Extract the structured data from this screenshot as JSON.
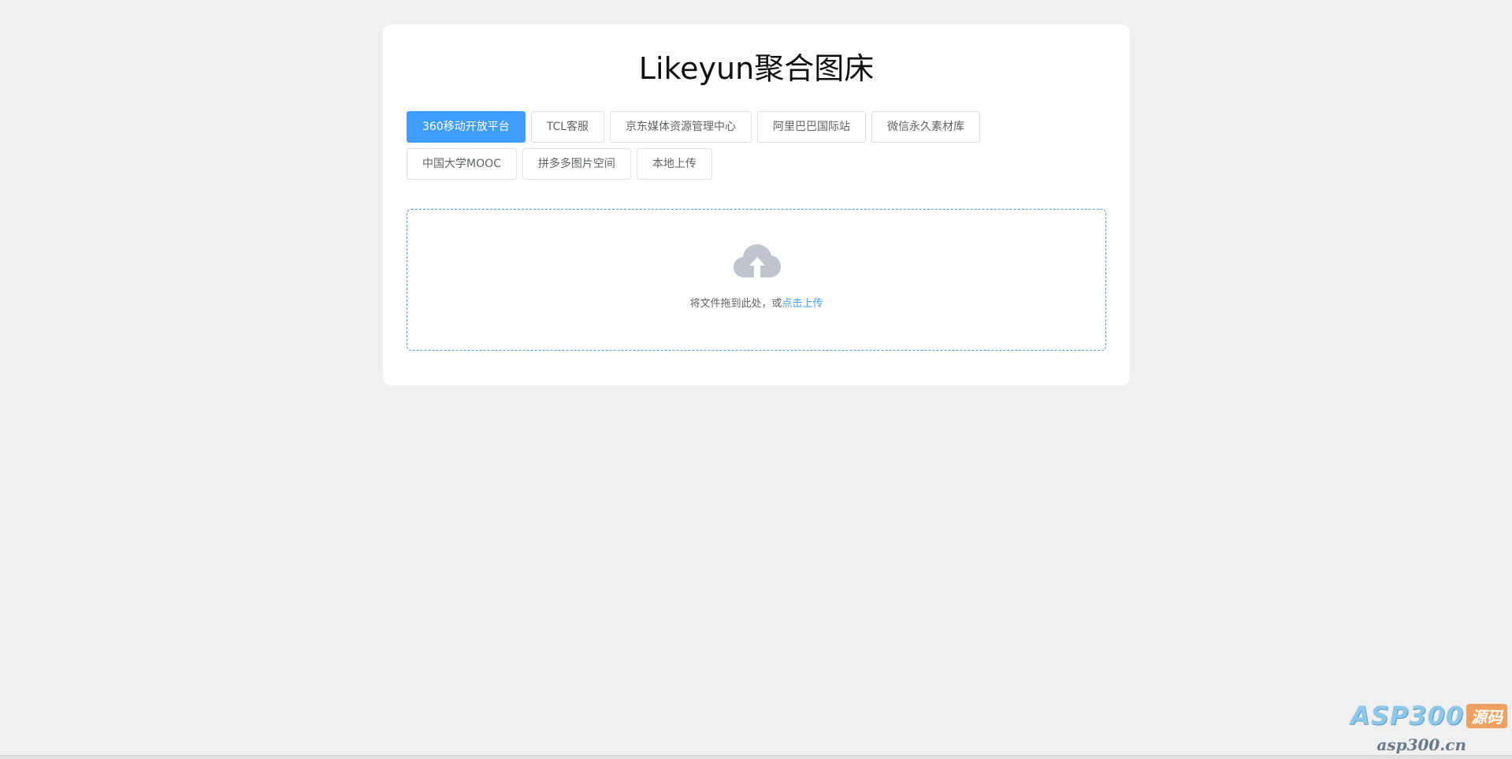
{
  "header": {
    "title": "Likeyun聚合图床"
  },
  "tabs": {
    "row1": [
      {
        "label": "360移动开放平台",
        "active": true
      },
      {
        "label": "TCL客服",
        "active": false
      },
      {
        "label": "京东媒体资源管理中心",
        "active": false
      },
      {
        "label": "阿里巴巴国际站",
        "active": false
      },
      {
        "label": "微信永久素材库",
        "active": false
      }
    ],
    "row2": [
      {
        "label": "中国大学MOOC",
        "active": false
      },
      {
        "label": "拼多多图片空间",
        "active": false
      },
      {
        "label": "本地上传",
        "active": false
      }
    ]
  },
  "upload": {
    "icon": "cloud-upload-icon",
    "text": "将文件拖到此处，或",
    "link": "点击上传"
  },
  "watermark": {
    "brand": "ASP300",
    "badge": "源码",
    "url": "asp300.cn"
  },
  "colors": {
    "accent": "#409eff",
    "page_bg": "#f0f0f0",
    "card_bg": "#ffffff",
    "icon_gray": "#c0c4cc"
  }
}
